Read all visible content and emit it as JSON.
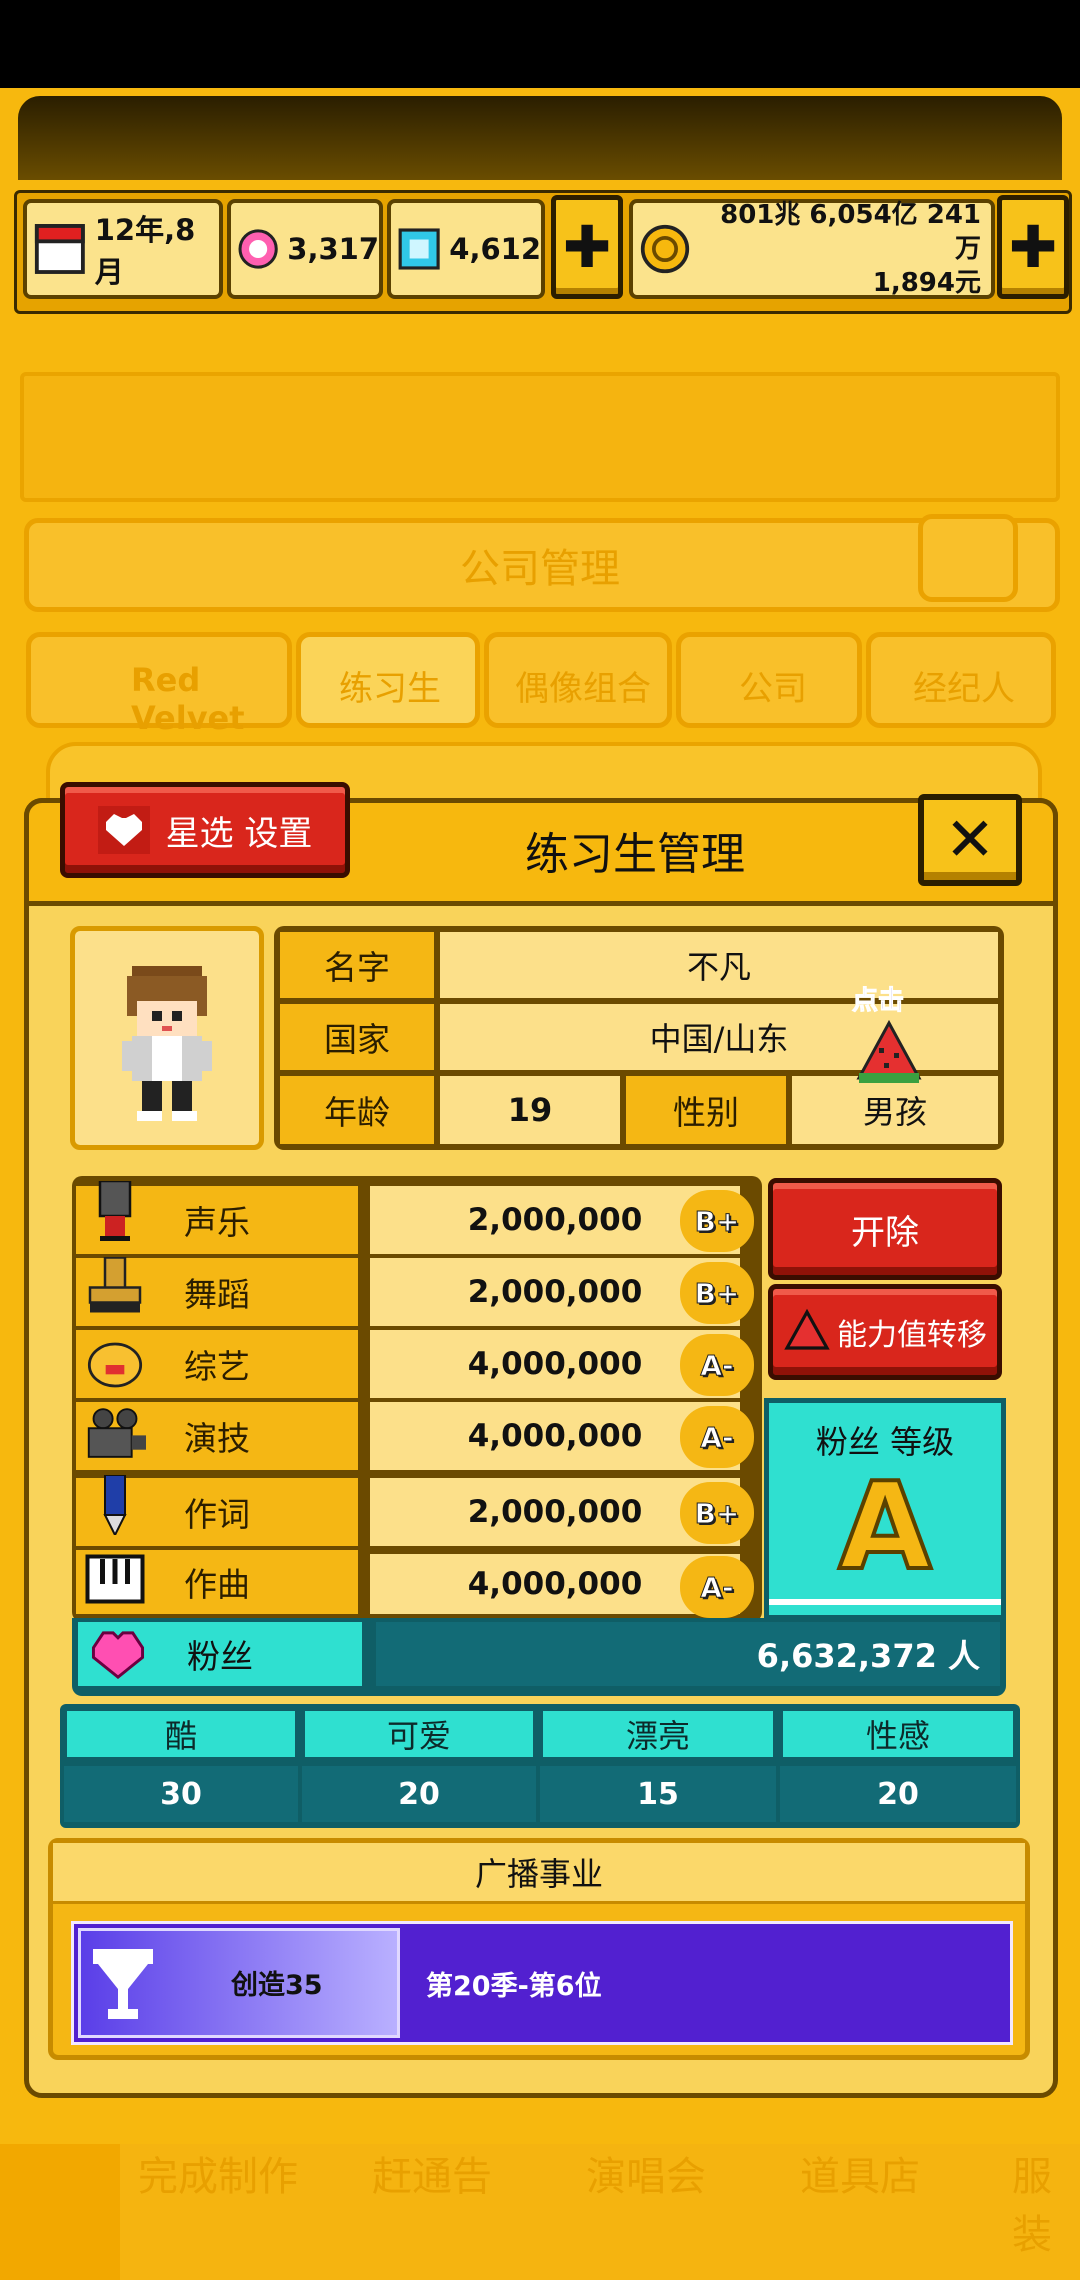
{
  "topbar": {
    "date": "12年,8月",
    "gems": "3,317",
    "diamonds": "4,612",
    "money_line1": "801兆 6,054亿 241万",
    "money_line2": "1,894元",
    "plus_label": "✚"
  },
  "background": {
    "panel_title": "公司管理",
    "tabs": [
      "Red Velvet",
      "练习生",
      "偶像组合",
      "公司",
      "经纪人"
    ],
    "bottom_nav": [
      "完成制作",
      "赶通告",
      "演唱会",
      "道具店",
      "服装"
    ]
  },
  "dialog": {
    "star_button": "星选 设置",
    "title": "练习生管理",
    "close_label": "✕",
    "profile": {
      "name_label": "名字",
      "name": "不凡",
      "country_label": "国家",
      "country": "中国/山东",
      "age_label": "年龄",
      "age": "19",
      "gender_label": "性别",
      "gender": "男孩",
      "tap_hint": "点击"
    },
    "skills": [
      {
        "label": "声乐",
        "value": "2,000,000",
        "grade": "B+"
      },
      {
        "label": "舞蹈",
        "value": "2,000,000",
        "grade": "B+"
      },
      {
        "label": "综艺",
        "value": "4,000,000",
        "grade": "A-"
      },
      {
        "label": "演技",
        "value": "4,000,000",
        "grade": "A-"
      },
      {
        "label": "作词",
        "value": "2,000,000",
        "grade": "B+"
      },
      {
        "label": "作曲",
        "value": "4,000,000",
        "grade": "A-"
      }
    ],
    "fire_button": "开除",
    "transfer_button": "能力值转移",
    "fan_level_label": "粉丝 等级",
    "fan_level_grade": "A",
    "fans_label": "粉丝",
    "fans_value": "6,632,372 人",
    "traits": [
      {
        "label": "酷",
        "value": "30"
      },
      {
        "label": "可爱",
        "value": "20"
      },
      {
        "label": "漂亮",
        "value": "15"
      },
      {
        "label": "性感",
        "value": "20"
      }
    ],
    "broadcast_title": "广播事业",
    "broadcast_show": "创造35",
    "broadcast_result": "第20季-第6位"
  }
}
